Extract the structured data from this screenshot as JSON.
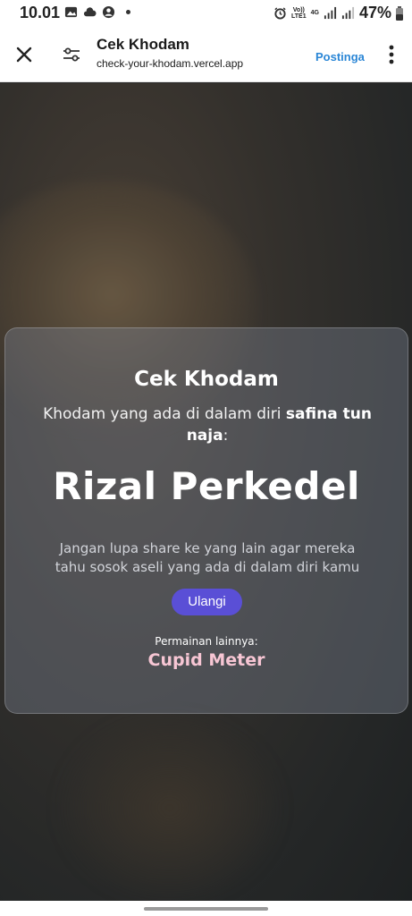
{
  "status_bar": {
    "time": "10.01",
    "icons_left": [
      "image-icon",
      "cloud-icon",
      "account-circle-icon",
      "dot-icon"
    ],
    "icons_right": [
      "alarm-icon",
      "volte-icon",
      "4g-icon",
      "signal-icon",
      "signal-icon",
      "battery-icon"
    ],
    "volte_text": "Vo))\nLTE1",
    "net_text": "4G",
    "battery": "47%"
  },
  "browser": {
    "title": "Cek Khodam",
    "url": "check-your-khodam.vercel.app",
    "post_label": "Postingan"
  },
  "card": {
    "title": "Cek Khodam",
    "desc_prefix": "Khodam yang ada di dalam diri ",
    "name": "safina tun naja",
    "desc_suffix": ":",
    "result": "Rizal Perkedel",
    "reminder": "Jangan lupa share ke yang lain agar mereka tahu sosok aseli yang ada di dalam diri kamu",
    "retry_label": "Ulangi",
    "more_label": "Permainan lainnya:",
    "more_link": "Cupid Meter"
  },
  "colors": {
    "accent_link": "#2a86d6",
    "retry_button": "#5a4fd6",
    "more_link": "#f7c6d4"
  }
}
